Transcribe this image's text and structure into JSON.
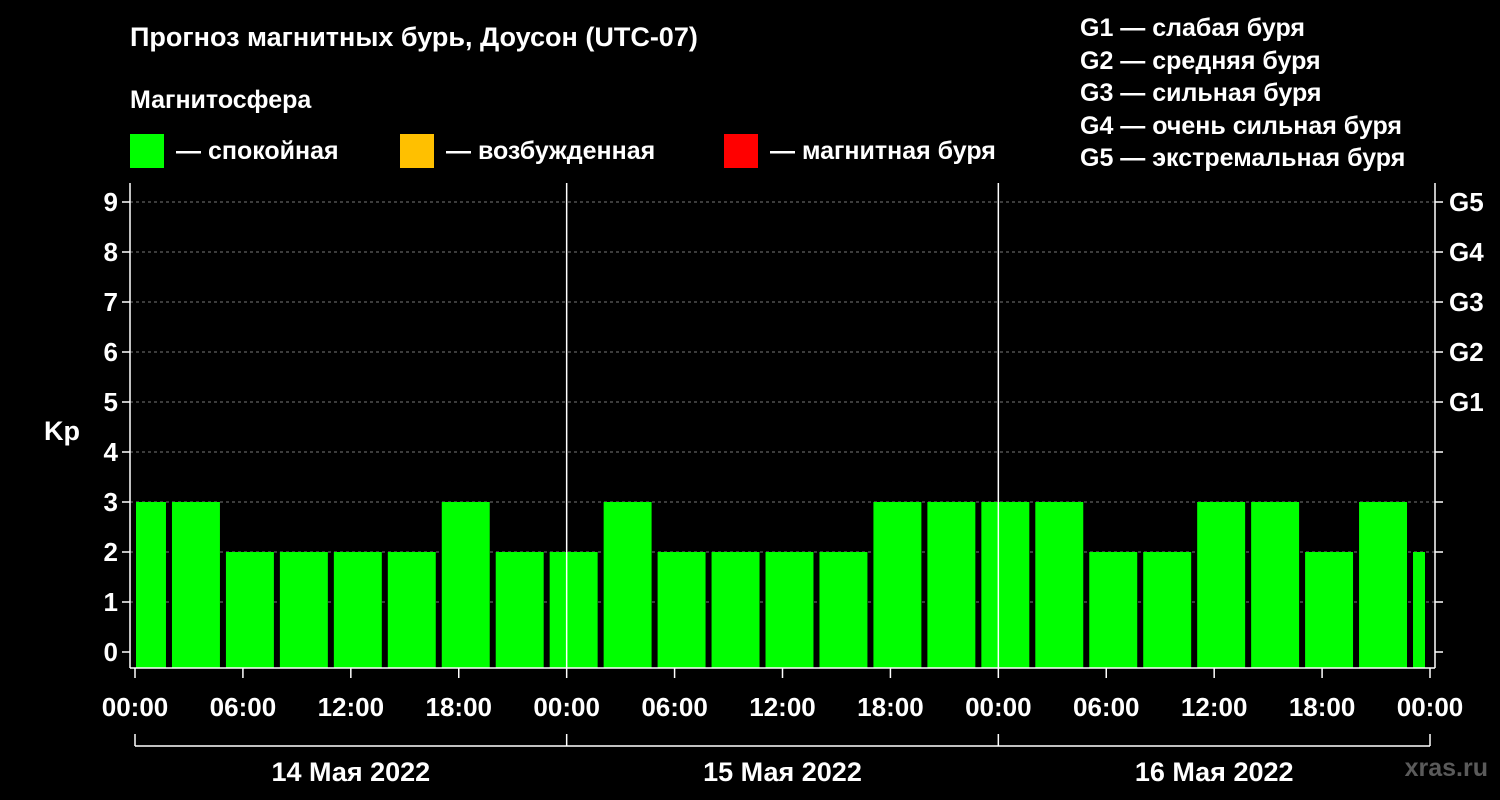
{
  "title": "Прогноз магнитных бурь, Доусон (UTC-07)",
  "subtitle": "Магнитосфера",
  "legend": [
    {
      "label": "— спокойная",
      "color": "#00ff00"
    },
    {
      "label": "— возбужденная",
      "color": "#ffc000"
    },
    {
      "label": "— магнитная буря",
      "color": "#ff0000"
    }
  ],
  "g_scale": [
    "G1 — слабая буря",
    "G2 — средняя буря",
    "G3 — сильная буря",
    "G4 — очень сильная буря",
    "G5 — экстремальная буря"
  ],
  "watermark": "xras.ru",
  "chart_data": {
    "type": "bar",
    "ylabel": "Kp",
    "ylim": [
      0,
      9
    ],
    "yticks": [
      0,
      1,
      2,
      3,
      4,
      5,
      6,
      7,
      8,
      9
    ],
    "right_axis_labels": [
      {
        "kp": 5,
        "label": "G1"
      },
      {
        "kp": 6,
        "label": "G2"
      },
      {
        "kp": 7,
        "label": "G3"
      },
      {
        "kp": 8,
        "label": "G4"
      },
      {
        "kp": 9,
        "label": "G5"
      }
    ],
    "x_range_hours": [
      0,
      72
    ],
    "xtick_labels": [
      "00:00",
      "06:00",
      "12:00",
      "18:00",
      "00:00",
      "06:00",
      "12:00",
      "18:00",
      "00:00",
      "06:00",
      "12:00",
      "18:00",
      "00:00"
    ],
    "day_labels": [
      "14 Мая 2022",
      "15 Мая 2022",
      "16 Мая 2022"
    ],
    "bar_color": "#00ff00",
    "grid": true,
    "bars": [
      {
        "start_hour": 0,
        "end_hour": 2,
        "kp": 3
      },
      {
        "start_hour": 2,
        "end_hour": 5,
        "kp": 3
      },
      {
        "start_hour": 5,
        "end_hour": 8,
        "kp": 2
      },
      {
        "start_hour": 8,
        "end_hour": 11,
        "kp": 2
      },
      {
        "start_hour": 11,
        "end_hour": 14,
        "kp": 2
      },
      {
        "start_hour": 14,
        "end_hour": 17,
        "kp": 2
      },
      {
        "start_hour": 17,
        "end_hour": 20,
        "kp": 3
      },
      {
        "start_hour": 20,
        "end_hour": 23,
        "kp": 2
      },
      {
        "start_hour": 23,
        "end_hour": 26,
        "kp": 2
      },
      {
        "start_hour": 26,
        "end_hour": 29,
        "kp": 3
      },
      {
        "start_hour": 29,
        "end_hour": 32,
        "kp": 2
      },
      {
        "start_hour": 32,
        "end_hour": 35,
        "kp": 2
      },
      {
        "start_hour": 35,
        "end_hour": 38,
        "kp": 2
      },
      {
        "start_hour": 38,
        "end_hour": 41,
        "kp": 2
      },
      {
        "start_hour": 41,
        "end_hour": 44,
        "kp": 3
      },
      {
        "start_hour": 44,
        "end_hour": 47,
        "kp": 3
      },
      {
        "start_hour": 47,
        "end_hour": 50,
        "kp": 3
      },
      {
        "start_hour": 50,
        "end_hour": 53,
        "kp": 3
      },
      {
        "start_hour": 53,
        "end_hour": 56,
        "kp": 2
      },
      {
        "start_hour": 56,
        "end_hour": 59,
        "kp": 2
      },
      {
        "start_hour": 59,
        "end_hour": 62,
        "kp": 3
      },
      {
        "start_hour": 62,
        "end_hour": 65,
        "kp": 3
      },
      {
        "start_hour": 65,
        "end_hour": 68,
        "kp": 2
      },
      {
        "start_hour": 68,
        "end_hour": 71,
        "kp": 3
      },
      {
        "start_hour": 71,
        "end_hour": 72,
        "kp": 2
      }
    ]
  }
}
